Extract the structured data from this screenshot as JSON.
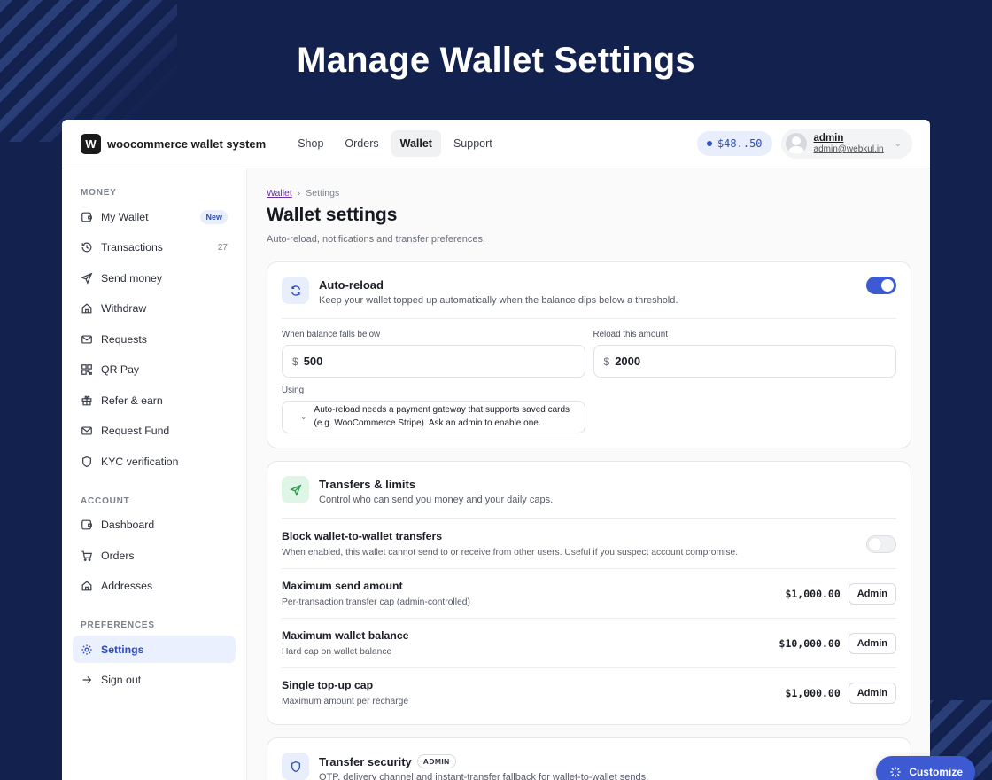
{
  "hero": {
    "title": "Manage Wallet Settings"
  },
  "topbar": {
    "logo_letter": "W",
    "brand": "woocommerce wallet system",
    "nav": [
      "Shop",
      "Orders",
      "Wallet",
      "Support"
    ],
    "active_nav": "Wallet",
    "balance": "$48..50",
    "user": {
      "name": "admin",
      "email": "admin@webkul.in"
    }
  },
  "sidebar": {
    "sections": [
      {
        "label": "MONEY",
        "items": [
          {
            "label": "My Wallet",
            "icon": "wallet-icon",
            "badge": "New"
          },
          {
            "label": "Transactions",
            "icon": "history-icon",
            "count": "27"
          },
          {
            "label": "Send money",
            "icon": "send-icon"
          },
          {
            "label": "Withdraw",
            "icon": "home-icon"
          },
          {
            "label": "Requests",
            "icon": "mail-icon"
          },
          {
            "label": "QR Pay",
            "icon": "qr-icon"
          },
          {
            "label": "Refer & earn",
            "icon": "gift-icon"
          },
          {
            "label": "Request Fund",
            "icon": "mail-icon"
          },
          {
            "label": "KYC verification",
            "icon": "shield-icon"
          }
        ]
      },
      {
        "label": "ACCOUNT",
        "items": [
          {
            "label": "Dashboard",
            "icon": "wallet-icon"
          },
          {
            "label": "Orders",
            "icon": "cart-icon"
          },
          {
            "label": "Addresses",
            "icon": "home-icon"
          }
        ]
      },
      {
        "label": "PREFERENCES",
        "items": [
          {
            "label": "Settings",
            "icon": "gear-icon",
            "active": true
          },
          {
            "label": "Sign out",
            "icon": "arrow-right-icon"
          }
        ]
      }
    ]
  },
  "main": {
    "breadcrumb": {
      "link": "Wallet",
      "separator": "›",
      "current": "Settings"
    },
    "title": "Wallet settings",
    "subtitle": "Auto-reload, notifications and transfer preferences.",
    "auto_reload": {
      "title": "Auto-reload",
      "desc": "Keep your wallet topped up automatically when the balance dips below a threshold.",
      "enabled": true,
      "threshold_label": "When balance falls below",
      "threshold_value": "500",
      "reload_label": "Reload this amount",
      "reload_value": "2000",
      "currency": "$",
      "using_label": "Using",
      "using_message": "Auto-reload needs a payment gateway that supports saved cards (e.g. WooCommerce Stripe). Ask an admin to enable one."
    },
    "transfers": {
      "title": "Transfers & limits",
      "desc": "Control who can send you money and your daily caps.",
      "block": {
        "title": "Block wallet-to-wallet transfers",
        "desc": "When enabled, this wallet cannot send to or receive from other users. Useful if you suspect account compromise.",
        "enabled": false
      },
      "limits": [
        {
          "title": "Maximum send amount",
          "desc": "Per-transaction transfer cap (admin-controlled)",
          "value": "$1,000.00",
          "button": "Admin"
        },
        {
          "title": "Maximum wallet balance",
          "desc": "Hard cap on wallet balance",
          "value": "$10,000.00",
          "button": "Admin"
        },
        {
          "title": "Single top-up cap",
          "desc": "Maximum amount per recharge",
          "value": "$1,000.00",
          "button": "Admin"
        }
      ]
    },
    "security": {
      "title": "Transfer security",
      "tag": "ADMIN",
      "desc": "OTP, delivery channel and instant-transfer fallback for wallet-to-wallet sends."
    }
  },
  "customize_button": "Customize",
  "colors": {
    "background": "#13214f",
    "accent": "#3d5ad3",
    "accent_soft": "#e8eefc"
  }
}
